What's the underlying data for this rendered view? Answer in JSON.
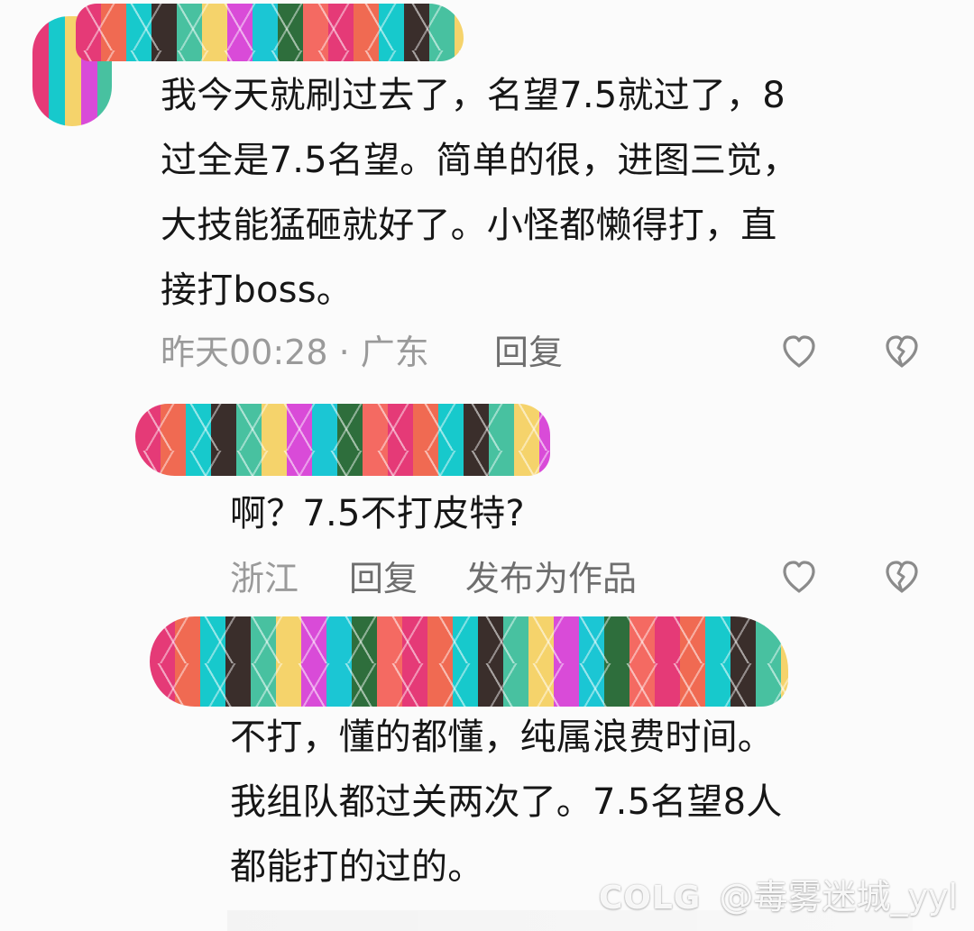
{
  "comments": [
    {
      "text": "我今天就刷过去了，名望7.5就过了，8\n过全是7.5名望。简单的很，进图三觉，\n大技能猛砸就好了。小怪都懒得打，直\n接打boss。",
      "meta": "昨天00:28 · 广东",
      "reply": "回复",
      "like_icon": "heart-outline-icon",
      "dislike_icon": "broken-heart-icon"
    },
    {
      "text": "啊？7.5不打皮特?",
      "meta": "浙江",
      "reply": "回复",
      "publish": "发布为作品",
      "like_icon": "heart-outline-icon",
      "dislike_icon": "broken-heart-icon"
    },
    {
      "text": "不打，懂的都懂，纯属浪费时间。\n我组队都过关两次了。7.5名望8人\n都能打的过的。"
    }
  ],
  "watermark": {
    "brand": "COLG",
    "handle": "@毒雾迷城_yyl"
  },
  "colors": {
    "background": "#fbfbfb",
    "text": "#161616",
    "meta": "#9a9a9a",
    "action": "#6e6e6e",
    "icon": "#8b8b8b"
  }
}
